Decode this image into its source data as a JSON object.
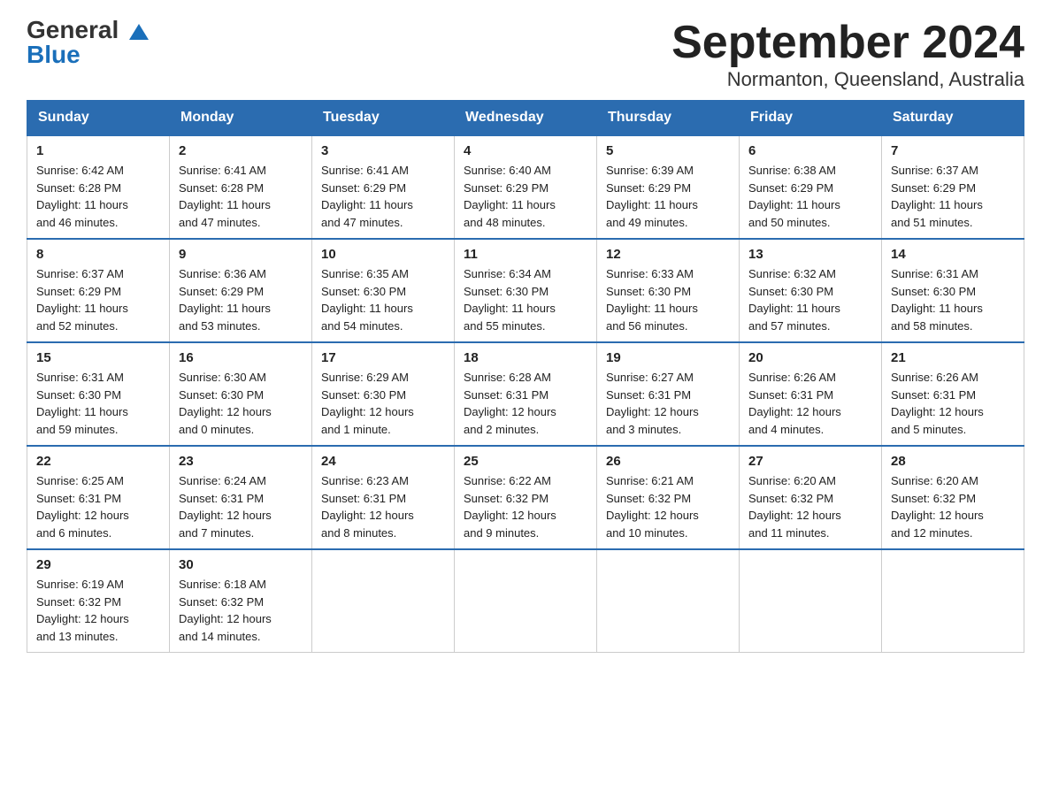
{
  "logo": {
    "general": "General",
    "blue": "Blue"
  },
  "title": "September 2024",
  "location": "Normanton, Queensland, Australia",
  "weekdays": [
    "Sunday",
    "Monday",
    "Tuesday",
    "Wednesday",
    "Thursday",
    "Friday",
    "Saturday"
  ],
  "weeks": [
    [
      {
        "day": "1",
        "sunrise": "6:42 AM",
        "sunset": "6:28 PM",
        "daylight": "11 hours and 46 minutes."
      },
      {
        "day": "2",
        "sunrise": "6:41 AM",
        "sunset": "6:28 PM",
        "daylight": "11 hours and 47 minutes."
      },
      {
        "day": "3",
        "sunrise": "6:41 AM",
        "sunset": "6:29 PM",
        "daylight": "11 hours and 47 minutes."
      },
      {
        "day": "4",
        "sunrise": "6:40 AM",
        "sunset": "6:29 PM",
        "daylight": "11 hours and 48 minutes."
      },
      {
        "day": "5",
        "sunrise": "6:39 AM",
        "sunset": "6:29 PM",
        "daylight": "11 hours and 49 minutes."
      },
      {
        "day": "6",
        "sunrise": "6:38 AM",
        "sunset": "6:29 PM",
        "daylight": "11 hours and 50 minutes."
      },
      {
        "day": "7",
        "sunrise": "6:37 AM",
        "sunset": "6:29 PM",
        "daylight": "11 hours and 51 minutes."
      }
    ],
    [
      {
        "day": "8",
        "sunrise": "6:37 AM",
        "sunset": "6:29 PM",
        "daylight": "11 hours and 52 minutes."
      },
      {
        "day": "9",
        "sunrise": "6:36 AM",
        "sunset": "6:29 PM",
        "daylight": "11 hours and 53 minutes."
      },
      {
        "day": "10",
        "sunrise": "6:35 AM",
        "sunset": "6:30 PM",
        "daylight": "11 hours and 54 minutes."
      },
      {
        "day": "11",
        "sunrise": "6:34 AM",
        "sunset": "6:30 PM",
        "daylight": "11 hours and 55 minutes."
      },
      {
        "day": "12",
        "sunrise": "6:33 AM",
        "sunset": "6:30 PM",
        "daylight": "11 hours and 56 minutes."
      },
      {
        "day": "13",
        "sunrise": "6:32 AM",
        "sunset": "6:30 PM",
        "daylight": "11 hours and 57 minutes."
      },
      {
        "day": "14",
        "sunrise": "6:31 AM",
        "sunset": "6:30 PM",
        "daylight": "11 hours and 58 minutes."
      }
    ],
    [
      {
        "day": "15",
        "sunrise": "6:31 AM",
        "sunset": "6:30 PM",
        "daylight": "11 hours and 59 minutes."
      },
      {
        "day": "16",
        "sunrise": "6:30 AM",
        "sunset": "6:30 PM",
        "daylight": "12 hours and 0 minutes."
      },
      {
        "day": "17",
        "sunrise": "6:29 AM",
        "sunset": "6:30 PM",
        "daylight": "12 hours and 1 minute."
      },
      {
        "day": "18",
        "sunrise": "6:28 AM",
        "sunset": "6:31 PM",
        "daylight": "12 hours and 2 minutes."
      },
      {
        "day": "19",
        "sunrise": "6:27 AM",
        "sunset": "6:31 PM",
        "daylight": "12 hours and 3 minutes."
      },
      {
        "day": "20",
        "sunrise": "6:26 AM",
        "sunset": "6:31 PM",
        "daylight": "12 hours and 4 minutes."
      },
      {
        "day": "21",
        "sunrise": "6:26 AM",
        "sunset": "6:31 PM",
        "daylight": "12 hours and 5 minutes."
      }
    ],
    [
      {
        "day": "22",
        "sunrise": "6:25 AM",
        "sunset": "6:31 PM",
        "daylight": "12 hours and 6 minutes."
      },
      {
        "day": "23",
        "sunrise": "6:24 AM",
        "sunset": "6:31 PM",
        "daylight": "12 hours and 7 minutes."
      },
      {
        "day": "24",
        "sunrise": "6:23 AM",
        "sunset": "6:31 PM",
        "daylight": "12 hours and 8 minutes."
      },
      {
        "day": "25",
        "sunrise": "6:22 AM",
        "sunset": "6:32 PM",
        "daylight": "12 hours and 9 minutes."
      },
      {
        "day": "26",
        "sunrise": "6:21 AM",
        "sunset": "6:32 PM",
        "daylight": "12 hours and 10 minutes."
      },
      {
        "day": "27",
        "sunrise": "6:20 AM",
        "sunset": "6:32 PM",
        "daylight": "12 hours and 11 minutes."
      },
      {
        "day": "28",
        "sunrise": "6:20 AM",
        "sunset": "6:32 PM",
        "daylight": "12 hours and 12 minutes."
      }
    ],
    [
      {
        "day": "29",
        "sunrise": "6:19 AM",
        "sunset": "6:32 PM",
        "daylight": "12 hours and 13 minutes."
      },
      {
        "day": "30",
        "sunrise": "6:18 AM",
        "sunset": "6:32 PM",
        "daylight": "12 hours and 14 minutes."
      },
      null,
      null,
      null,
      null,
      null
    ]
  ],
  "labels": {
    "sunrise": "Sunrise:",
    "sunset": "Sunset:",
    "daylight": "Daylight:"
  }
}
